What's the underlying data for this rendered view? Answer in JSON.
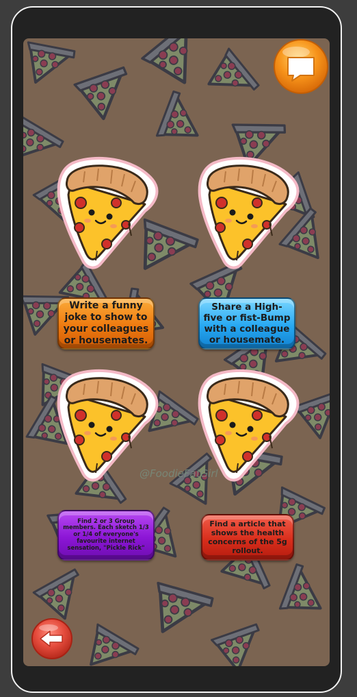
{
  "tasks": [
    {
      "id": "joke",
      "text": "Write a funny joke to show to your colleagues or housemates.",
      "color": "#f08410"
    },
    {
      "id": "high-five",
      "text": "Share a High-five or fist-Bump with a colleague or housemate.",
      "color": "#27a8f2"
    },
    {
      "id": "sketch",
      "text": "Find 2 or 3 Group members. Each sketch 1/3 or 1/4 of everyone's favourite internet sensation, \"Pickle Rick\"",
      "color": "#8c16d6"
    },
    {
      "id": "article",
      "text": "Find a article that shows the health concerns of the 5g rollout.",
      "color": "#d82e1c"
    }
  ],
  "watermark": "@FoodieFatGirl",
  "icons": {
    "top_right": "speech-bubble-icon",
    "bottom_left": "back-arrow-icon"
  },
  "colors": {
    "background": "#7b6451",
    "pizza_crust": "#e0a36a",
    "pizza_cheese": "#fcc22a",
    "pepperoni": "#d0312b",
    "orange_button": "#f7931a",
    "red_button": "#e44b3c"
  }
}
